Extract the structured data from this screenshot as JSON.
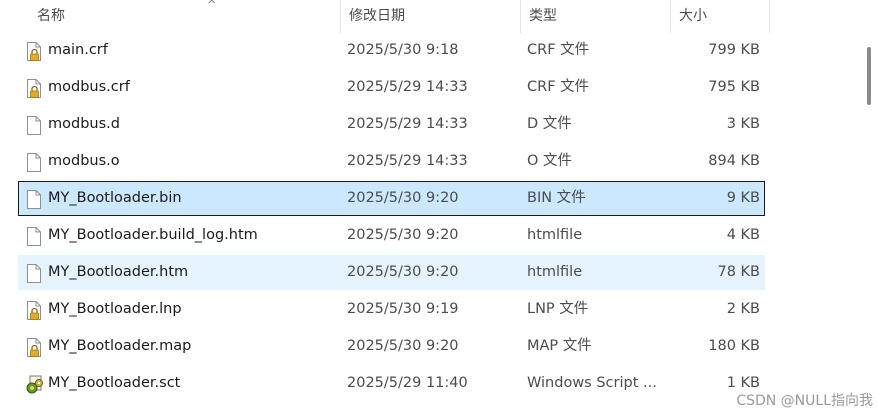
{
  "columns": {
    "name": "名称",
    "date": "修改日期",
    "type": "类型",
    "size": "大小"
  },
  "sort_indicator": "^",
  "files": [
    {
      "name": "main.crf",
      "date": "2025/5/30 9:18",
      "type": "CRF 文件",
      "size": "799 KB",
      "icon": "locked-file-icon",
      "state": "normal"
    },
    {
      "name": "modbus.crf",
      "date": "2025/5/29 14:33",
      "type": "CRF 文件",
      "size": "795 KB",
      "icon": "locked-file-icon",
      "state": "normal"
    },
    {
      "name": "modbus.d",
      "date": "2025/5/29 14:33",
      "type": "D 文件",
      "size": "3 KB",
      "icon": "file-icon",
      "state": "normal"
    },
    {
      "name": "modbus.o",
      "date": "2025/5/29 14:33",
      "type": "O 文件",
      "size": "894 KB",
      "icon": "file-icon",
      "state": "normal"
    },
    {
      "name": "MY_Bootloader.bin",
      "date": "2025/5/30 9:20",
      "type": "BIN 文件",
      "size": "9 KB",
      "icon": "file-icon",
      "state": "selected"
    },
    {
      "name": "MY_Bootloader.build_log.htm",
      "date": "2025/5/30 9:20",
      "type": "htmlfile",
      "size": "4 KB",
      "icon": "file-icon",
      "state": "normal"
    },
    {
      "name": "MY_Bootloader.htm",
      "date": "2025/5/30 9:20",
      "type": "htmlfile",
      "size": "78 KB",
      "icon": "file-icon",
      "state": "hover"
    },
    {
      "name": "MY_Bootloader.lnp",
      "date": "2025/5/30 9:19",
      "type": "LNP 文件",
      "size": "2 KB",
      "icon": "locked-file-icon",
      "state": "normal"
    },
    {
      "name": "MY_Bootloader.map",
      "date": "2025/5/30 9:20",
      "type": "MAP 文件",
      "size": "180 KB",
      "icon": "locked-file-icon",
      "state": "normal"
    },
    {
      "name": "MY_Bootloader.sct",
      "date": "2025/5/29 11:40",
      "type": "Windows Script ...",
      "size": "1 KB",
      "icon": "script-file-icon",
      "state": "normal"
    }
  ],
  "watermark": "CSDN @NULL指向我",
  "colors": {
    "selected_bg": "#cce8ff",
    "hover_bg": "#e5f3ff",
    "lock": "#d9a21b"
  }
}
